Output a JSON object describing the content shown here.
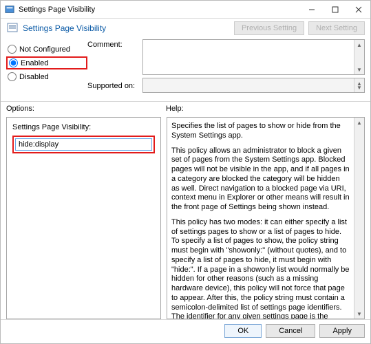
{
  "window": {
    "title": "Settings Page Visibility"
  },
  "header": {
    "page_title": "Settings Page Visibility",
    "prev_label": "Previous Setting",
    "next_label": "Next Setting"
  },
  "radios": {
    "not_configured": "Not Configured",
    "enabled": "Enabled",
    "disabled": "Disabled",
    "selected": "Enabled"
  },
  "fields": {
    "comment_label": "Comment:",
    "supported_label": "Supported on:",
    "comment_value": "",
    "supported_value": ""
  },
  "labels": {
    "options": "Options:",
    "help": "Help:"
  },
  "options": {
    "label": "Settings Page Visibility:",
    "value": "hide:display"
  },
  "help": {
    "p1": "Specifies the list of pages to show or hide from the System Settings app.",
    "p2": "This policy allows an administrator to block a given set of pages from the System Settings app. Blocked pages will not be visible in the app, and if all pages in a category are blocked the category will be hidden as well. Direct navigation to a blocked page via URI, context menu in Explorer or other means will result in the front page of Settings being shown instead.",
    "p3": "This policy has two modes: it can either specify a list of settings pages to show or a list of pages to hide. To specify a list of pages to show, the policy string must begin with \"showonly:\" (without quotes), and to specify a list of pages to hide, it must begin with \"hide:\". If a page in a showonly list would normally be hidden for other reasons (such as a missing hardware device), this policy will not force that page to appear. After this, the policy string must contain a semicolon-delimited list of settings page identifiers. The identifier for any given settings page is the published URI for that page, minus the \"ms-settings:\" protocol part."
  },
  "footer": {
    "ok": "OK",
    "cancel": "Cancel",
    "apply": "Apply"
  }
}
